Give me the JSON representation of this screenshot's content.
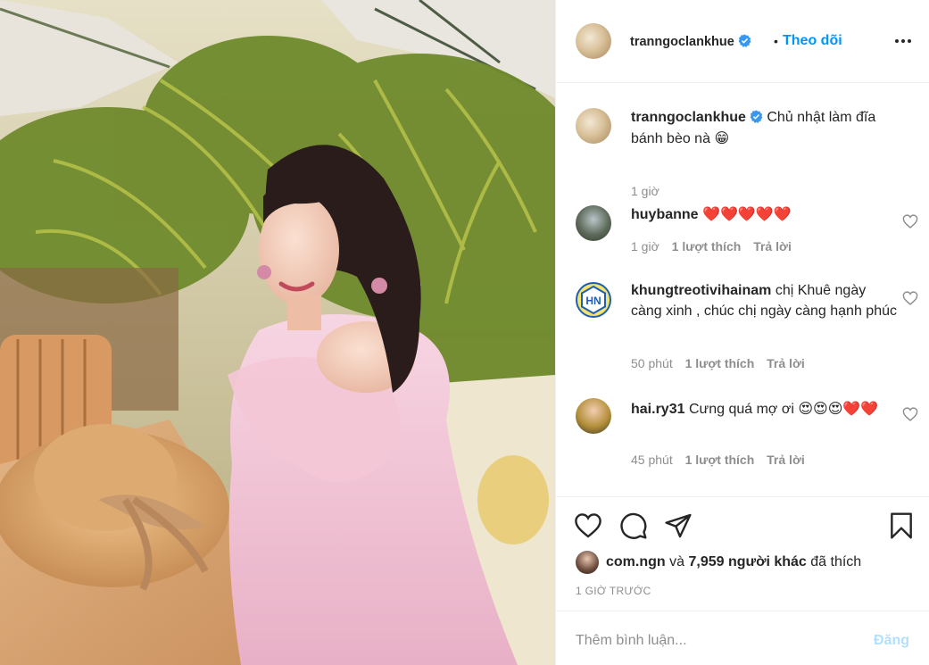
{
  "post": {
    "username": "tranngoclankhue",
    "follow_dot": "•",
    "follow_label": "Theo dõi",
    "caption_text": "Chủ nhật làm đĩa bánh bèo nà",
    "caption_emoji": "😁",
    "caption_time": "1 giờ"
  },
  "comments": [
    {
      "username": "huybanne",
      "text": "",
      "emoji": "❤️❤️❤️❤️❤️",
      "time": "1 giờ",
      "likes": "1 lượt thích",
      "reply": "Trả lời"
    },
    {
      "username": "khungtreotivihainam",
      "text": "chị Khuê ngày càng xinh , chúc chị ngày càng hạnh phúc",
      "emoji": "",
      "time": "50 phút",
      "likes": "1 lượt thích",
      "reply": "Trả lời",
      "avatar_letters": "HN"
    },
    {
      "username": "hai.ry31",
      "text": "Cưng quá mợ ơi",
      "emoji": "😍😍😍❤️❤️",
      "time": "45 phút",
      "likes": "1 lượt thích",
      "reply": "Trả lời"
    }
  ],
  "actions": {
    "liked_by_user": "com.ngn",
    "liked_by_mid": " và ",
    "liked_count": "7,959 người khác",
    "liked_suffix": " đã thích",
    "timestamp": "1 GIỜ TRƯỚC"
  },
  "comment_box": {
    "placeholder": "Thêm bình luận...",
    "post_label": "Đăng"
  },
  "colors": {
    "accent": "#0095f6",
    "verified": "#3897f0",
    "muted": "#8e8e8e",
    "heart": "#ed4956",
    "post_disabled": "#b2dffc"
  },
  "icons": [
    "verified-icon",
    "more-options-icon",
    "heart-icon",
    "comment-icon",
    "share-icon",
    "bookmark-icon"
  ]
}
